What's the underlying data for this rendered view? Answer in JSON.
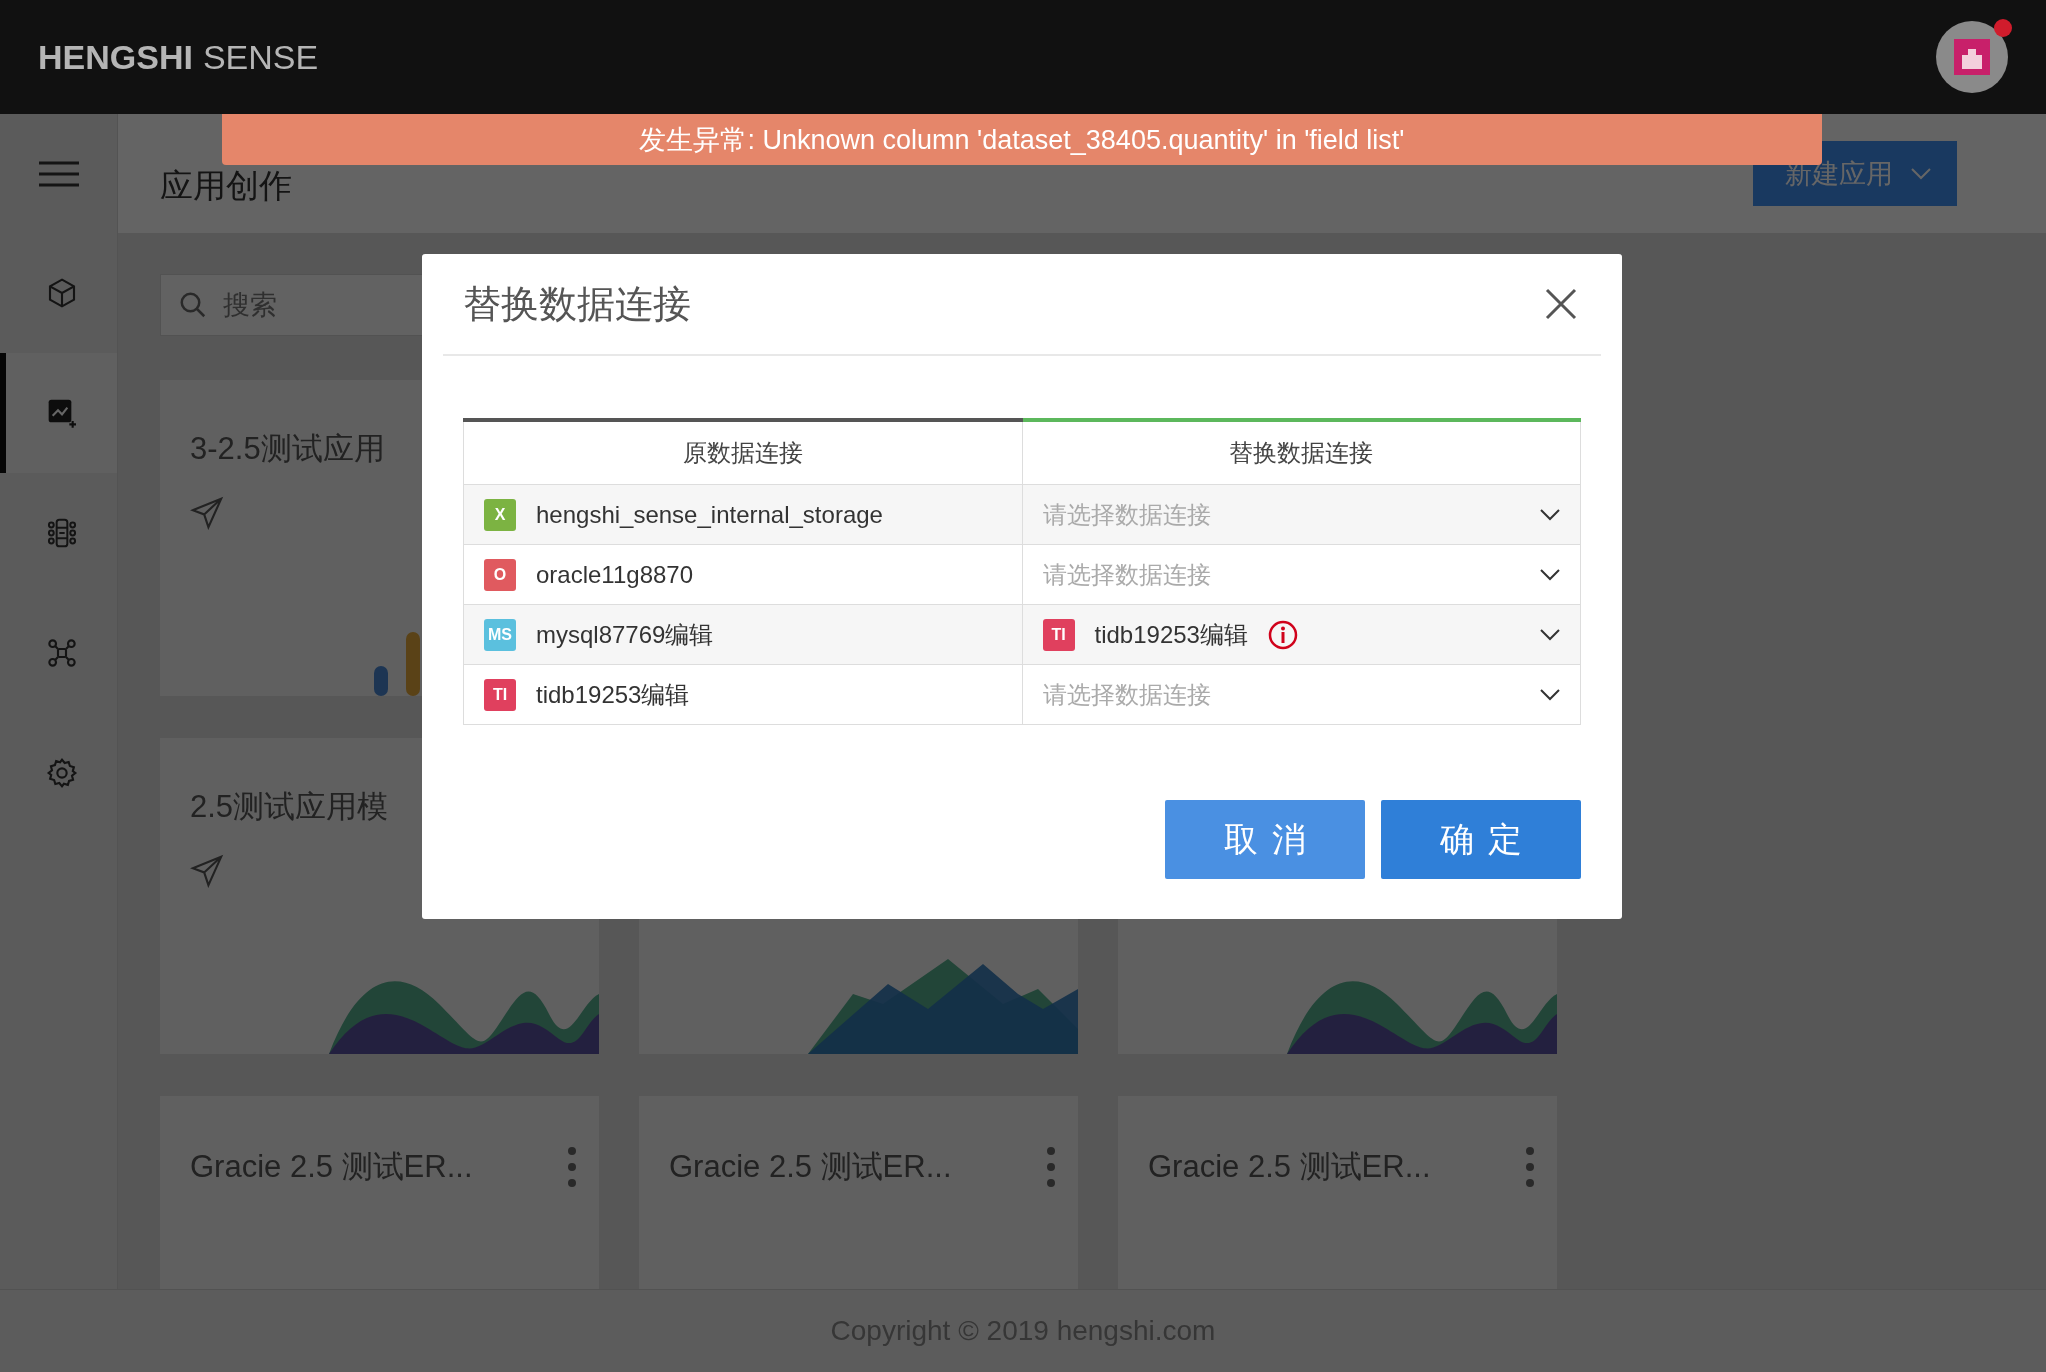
{
  "topbar": {
    "logo_bold": "HENGSHI",
    "logo_light": "SENSE",
    "notification": true
  },
  "sidebar": {
    "items": [
      {
        "kind": "cube",
        "selected": false
      },
      {
        "kind": "chart",
        "selected": true
      },
      {
        "kind": "tree",
        "selected": false
      },
      {
        "kind": "network",
        "selected": false
      },
      {
        "kind": "gear",
        "selected": false
      }
    ]
  },
  "page": {
    "title": "应用创作",
    "new_button": "新建应用",
    "search": {
      "placeholder": "搜索"
    }
  },
  "card_rows": [
    [
      {
        "title": "3-2.5测试应用",
        "kind": "bars"
      }
    ],
    [
      {
        "title": "2.5测试应用模",
        "kind": "waves"
      },
      {
        "kind": "peaks"
      },
      {
        "kind": "waves"
      }
    ],
    [
      {
        "title": "Gracie 2.5 测试ER...",
        "kind": "menu"
      },
      {
        "title": "Gracie 2.5 测试ER...",
        "kind": "menu"
      },
      {
        "title": "Gracie 2.5 测试ER...",
        "kind": "menu"
      }
    ]
  ],
  "footer": "Copyright © 2019 hengshi.com",
  "error_banner": "发生异常: Unknown column 'dataset_38405.quantity' in 'field list'",
  "dialog": {
    "title": "替换数据连接",
    "columns": [
      "原数据连接",
      "替换数据连接"
    ],
    "rows": [
      {
        "source": {
          "badge": "X",
          "color": "#7cb342",
          "name": "hengshi_sense_internal_storage"
        },
        "target": {
          "placeholder": "请选择数据连接"
        }
      },
      {
        "source": {
          "badge": "O",
          "color": "#e05a5f",
          "name": "oracle11g8870"
        },
        "target": {
          "placeholder": "请选择数据连接"
        }
      },
      {
        "source": {
          "badge": "MS",
          "color": "#5bc0de",
          "name": "mysql87769编辑"
        },
        "target": {
          "badge": "TI",
          "color": "#e0405e",
          "name": "tidb19253编辑",
          "warning": true
        }
      },
      {
        "source": {
          "badge": "TI",
          "color": "#e0405e",
          "name": "tidb19253编辑"
        },
        "target": {
          "placeholder": "请选择数据连接"
        }
      }
    ],
    "buttons": [
      {
        "label": "取消",
        "kind": "secondary"
      },
      {
        "label": "确定",
        "kind": "primary"
      }
    ]
  }
}
